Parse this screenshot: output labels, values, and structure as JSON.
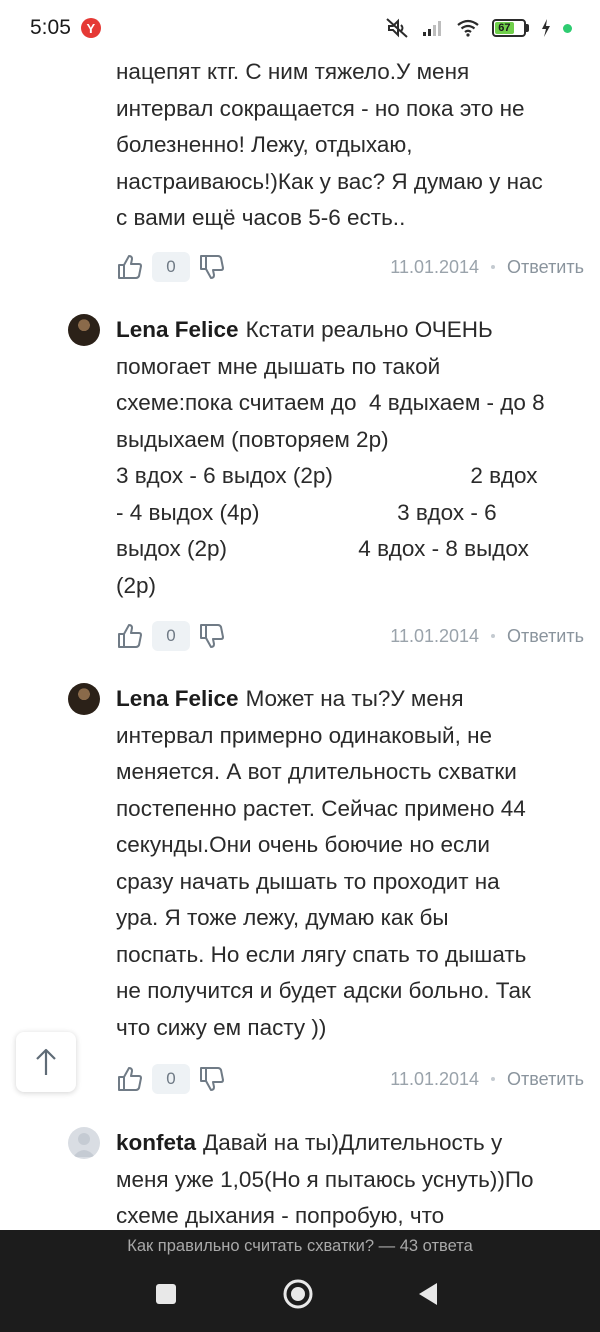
{
  "status_bar": {
    "time": "5:05",
    "notification_badge": "Y",
    "battery_level": "67",
    "icons": [
      "mute-icon",
      "signal-icon",
      "wifi-icon",
      "battery-icon",
      "charging-icon"
    ]
  },
  "comments": [
    {
      "author": "",
      "text": "нацепят ктг. С ним тяжело.У меня\nинтервал сокращается - но пока это не\nболезненно! Лежу, отдыхаю,\nнастраиваюсь!)Как у вас? Я думаю у нас\nс вами ещё часов 5-6 есть..",
      "likes": "0",
      "date": "11.01.2014",
      "reply_label": "Ответить"
    },
    {
      "author": "Lena Felice",
      "text": "Кстати реально ОЧЕНЬ\nпомогает мне дышать по такой\nсхеме:пока считаем до  4 вдыхаем - до 8\nвыдыхаем (повторяем 2р)\n3 вдох - 6 выдох (2р)                      2 вдох\n- 4 выдох (4р)                      3 вдох - 6\nвыдох (2р)                     4 вдох - 8 выдох\n(2р)",
      "likes": "0",
      "date": "11.01.2014",
      "reply_label": "Ответить"
    },
    {
      "author": "Lena Felice",
      "text": "Может на ты?У меня\nинтервал примерно одинаковый, не\nменяется. А вот длительность схватки\nпостепенно растет. Сейчас примено 44\nсекунды.Они очень боючие но если\nсразу начать дышать то проходит на\nура. Я тоже лежу, думаю как бы\nпоспать. Но если лягу спать то дышать\nне получится и будет адски больно. Так\nчто сижу ем пасту ))",
      "likes": "0",
      "date": "11.01.2014",
      "reply_label": "Ответить"
    },
    {
      "author": "konfeta",
      "text": "Давай на ты)Длительность у\nменя уже 1,05(Но я пытаюсь уснуть))По\nсхеме дыхания - попробую, что"
    }
  ],
  "scroll_top_icon": "arrow-up-icon",
  "bottom_bar": {
    "thread_title": "Как правильно считать схватки? — 43 ответа",
    "nav_icons": [
      "recents-square-icon",
      "home-circle-icon",
      "back-triangle-icon"
    ]
  },
  "colors": {
    "bottom_bar_bg": "#1c1c1c",
    "count_bg": "#eef2f5",
    "battery_fill": "#6fcf4a",
    "badge_red": "#e53935"
  }
}
